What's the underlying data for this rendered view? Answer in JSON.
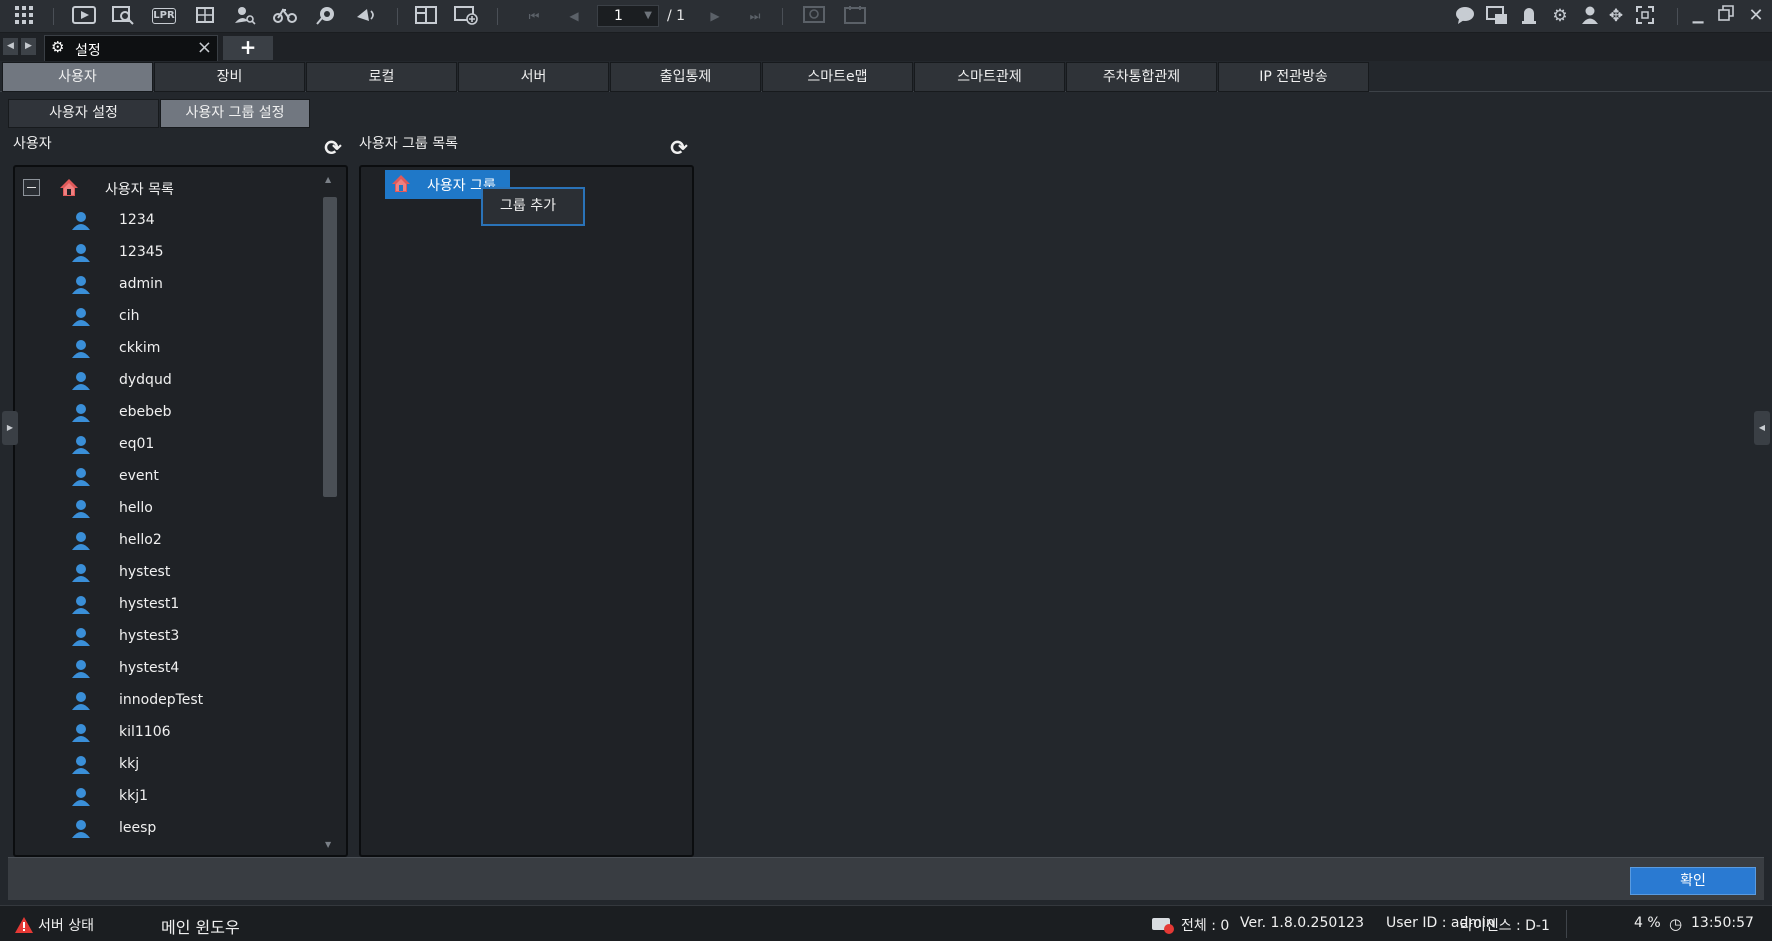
{
  "toolbar": {
    "page_current": "1",
    "page_total": "/ 1",
    "icons_left": [
      "grid-menu-icon",
      "play-video-icon",
      "search-playback-icon",
      "lpr-icon",
      "camera-grid-icon",
      "person-search-icon",
      "bicycle-icon",
      "camera-search-icon",
      "broadcast-icon",
      "layout-icon",
      "add-screen-icon"
    ],
    "lpr_text": "LPR",
    "icons_right": [
      "chat-icon",
      "notification-icon",
      "alarm-icon",
      "gear-icon",
      "user-icon",
      "move-icon",
      "fullscreen-icon",
      "minimize-icon",
      "restore-icon",
      "close-icon"
    ]
  },
  "tabstrip": {
    "doc_tab_title": "설정",
    "add_tab": "+"
  },
  "main_tabs": [
    "사용자",
    "장비",
    "로컬",
    "서버",
    "출입통제",
    "스마트e맵",
    "스마트관제",
    "주차통합관제",
    "IP 전관방송"
  ],
  "sub_tabs": [
    "사용자 설정",
    "사용자 그룹 설정"
  ],
  "left_panel": {
    "label": "사용자",
    "root": "사용자 목록",
    "users": [
      "1234",
      "12345",
      "admin",
      "cih",
      "ckkim",
      "dydqud",
      "ebebeb",
      "eq01",
      "event",
      "hello",
      "hello2",
      "hystest",
      "hystest1",
      "hystest3",
      "hystest4",
      "innodepTest",
      "kil1106",
      "kkj",
      "kkj1",
      "leesp"
    ]
  },
  "right_panel": {
    "label": "사용자 그룹 목록",
    "group": "사용자 그룹",
    "context_menu_item": "그룹 추가"
  },
  "bottom": {
    "ok": "확인"
  },
  "statusbar": {
    "server_status": "서버 상태",
    "main_window": "메인 윈도우",
    "total": "전체 : 0",
    "version": "Ver. 1.8.0.250123",
    "user_id": "User ID : admin",
    "license": "라이센스 : D-1",
    "cpu": "4 %",
    "time": "13:50:57"
  },
  "colors": {
    "accent": "#2a7ad2",
    "selected_node": "#1f78c8",
    "active_tab": "#717780",
    "user_icon": "#3a8fd8",
    "house_icon": "#e05a5a",
    "warning": "#e53935"
  }
}
